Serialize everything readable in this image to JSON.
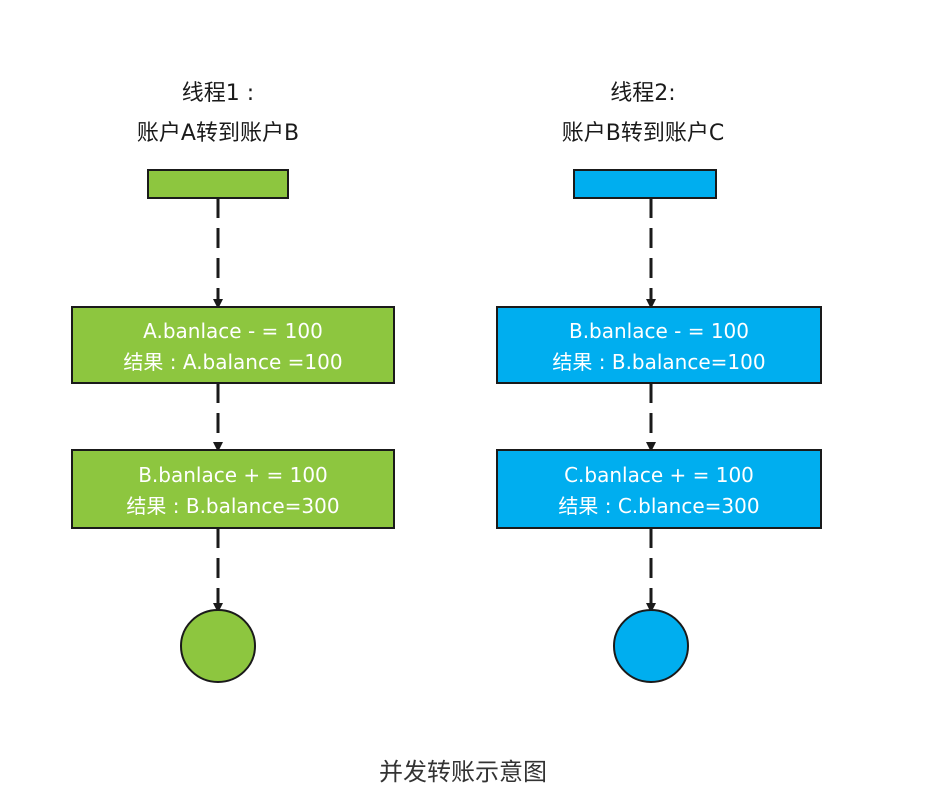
{
  "colors": {
    "thread1_fill": "#8dc63f",
    "thread2_fill": "#00aeef",
    "stroke": "#1a1a1a",
    "text_on_box": "#ffffff"
  },
  "thread1": {
    "title_line1": "线程1 :",
    "title_line2": "账户A转到账户B",
    "step1_line1": "A.banlace - = 100",
    "step1_line2": "结果 : A.balance =100",
    "step2_line1": "B.banlace + = 100",
    "step2_line2": "结果 :  B.balance=300"
  },
  "thread2": {
    "title_line1": "线程2:",
    "title_line2": "账户B转到账户C",
    "step1_line1": "B.banlace - = 100",
    "step1_line2": "结果 :  B.balance=100",
    "step2_line1": "C.banlace + = 100",
    "step2_line2": "结果 :  C.blance=300"
  },
  "caption": "并发转账示意图"
}
